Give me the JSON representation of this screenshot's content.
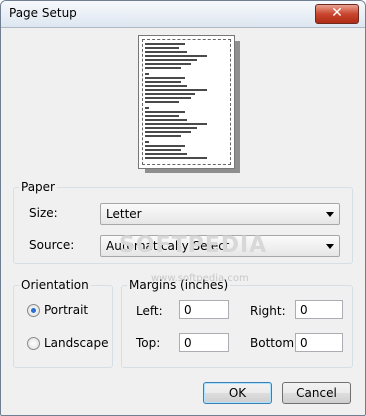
{
  "window": {
    "title": "Page Setup",
    "close_symbol": "✕"
  },
  "paper": {
    "legend": "Paper",
    "size_label": "Size:",
    "size_value": "Letter",
    "source_label": "Source:",
    "source_value": "Automatically Select"
  },
  "orientation": {
    "legend": "Orientation",
    "portrait": "Portrait",
    "landscape": "Landscape",
    "selected": "Portrait"
  },
  "margins": {
    "legend": "Margins (inches)",
    "left_label": "Left:",
    "left_value": "0",
    "right_label": "Right:",
    "right_value": "0",
    "top_label": "Top:",
    "top_value": "0",
    "bottom_label": "Bottom:",
    "bottom_value": "0"
  },
  "buttons": {
    "ok": "OK",
    "cancel": "Cancel"
  },
  "watermark": {
    "text": "SOFTPEDIA",
    "url": "www.softpedia.com"
  }
}
